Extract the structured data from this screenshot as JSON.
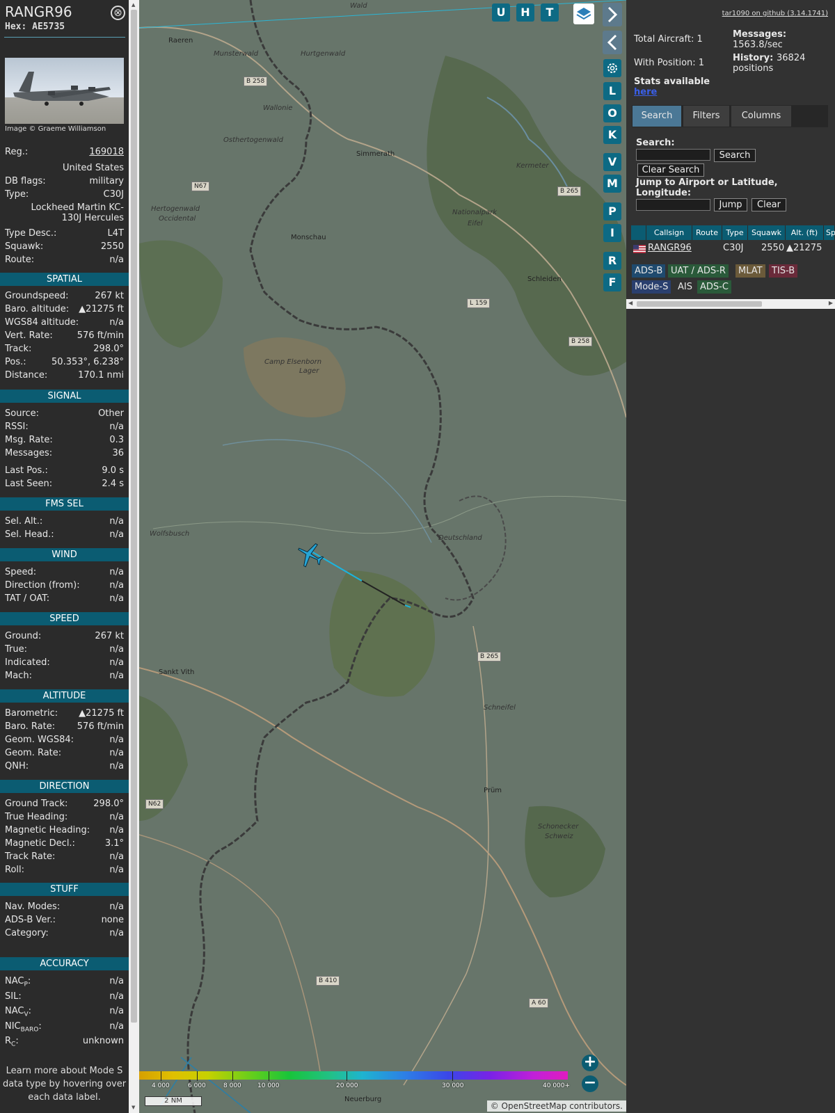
{
  "info": {
    "callsign": "RANGR96",
    "hex": "Hex: AE5735",
    "close": "⊗",
    "image_credit": "Image © Graeme Williamson",
    "reg_label": "Reg.:",
    "reg_value": "169018",
    "country": "United States",
    "dbflags_label": "DB flags:",
    "dbflags_value": "military",
    "type_label": "Type:",
    "type_value": "C30J",
    "type_full": "Lockheed Martin KC-130J Hercules",
    "typedesc_label": "Type Desc.:",
    "typedesc_value": "L4T",
    "squawk_label": "Squawk:",
    "squawk_value": "2550",
    "route_label": "Route:",
    "route_value": "n/a",
    "sections": {
      "spatial": "SPATIAL",
      "signal": "SIGNAL",
      "fms": "FMS SEL",
      "wind": "WIND",
      "speed": "SPEED",
      "altitude": "ALTITUDE",
      "direction": "DIRECTION",
      "stuff": "STUFF",
      "accuracy": "ACCURACY"
    },
    "spatial_rows": [
      [
        "Groundspeed:",
        "267 kt"
      ],
      [
        "Baro. altitude:",
        "▲21275 ft"
      ],
      [
        "WGS84 altitude:",
        "n/a"
      ],
      [
        "Vert. Rate:",
        "576 ft/min"
      ],
      [
        "Track:",
        "298.0°"
      ],
      [
        "Pos.:",
        "50.353°, 6.238°"
      ],
      [
        "Distance:",
        "170.1 nmi"
      ]
    ],
    "signal_rows": [
      [
        "Source:",
        "Other"
      ],
      [
        "RSSI:",
        "n/a"
      ],
      [
        "Msg. Rate:",
        "0.3"
      ],
      [
        "Messages:",
        "36"
      ]
    ],
    "signal_rows2": [
      [
        "Last Pos.:",
        "9.0 s"
      ],
      [
        "Last Seen:",
        "2.4 s"
      ]
    ],
    "fms_rows": [
      [
        "Sel. Alt.:",
        "n/a"
      ],
      [
        "Sel. Head.:",
        "n/a"
      ]
    ],
    "wind_rows": [
      [
        "Speed:",
        "n/a"
      ],
      [
        "Direction (from):",
        "n/a"
      ],
      [
        "TAT / OAT:",
        "n/a"
      ]
    ],
    "speed_rows": [
      [
        "Ground:",
        "267 kt"
      ],
      [
        "True:",
        "n/a"
      ],
      [
        "Indicated:",
        "n/a"
      ],
      [
        "Mach:",
        "n/a"
      ]
    ],
    "altitude_rows": [
      [
        "Barometric:",
        "▲21275 ft"
      ],
      [
        "Baro. Rate:",
        "576 ft/min"
      ],
      [
        "Geom. WGS84:",
        "n/a"
      ],
      [
        "Geom. Rate:",
        "n/a"
      ],
      [
        "QNH:",
        "n/a"
      ]
    ],
    "direction_rows": [
      [
        "Ground Track:",
        "298.0°"
      ],
      [
        "True Heading:",
        "n/a"
      ],
      [
        "Magnetic Heading:",
        "n/a"
      ],
      [
        "Magnetic Decl.:",
        "3.1°"
      ],
      [
        "Track Rate:",
        "n/a"
      ],
      [
        "Roll:",
        "n/a"
      ]
    ],
    "stuff_rows": [
      [
        "Nav. Modes:",
        "n/a"
      ],
      [
        "ADS-B Ver.:",
        "none"
      ],
      [
        "Category:",
        "n/a"
      ]
    ],
    "accuracy_rows": [
      [
        "NAC",
        "P",
        ":",
        "n/a"
      ],
      [
        "SIL:",
        "",
        "",
        "n/a"
      ],
      [
        "NAC",
        "V",
        ":",
        "n/a"
      ],
      [
        "NIC",
        "BARO",
        ":",
        "n/a"
      ],
      [
        "R",
        "C",
        ":",
        "unknown"
      ]
    ],
    "footer": "Learn more about Mode S data type by hovering over each data label."
  },
  "map": {
    "buttons_top": [
      "U",
      "H",
      "T"
    ],
    "buttons_side": [
      "L",
      "O",
      "K",
      "V",
      "M",
      "P",
      "I",
      "R",
      "F"
    ],
    "places": [
      [
        "Raeren",
        42,
        53,
        false
      ],
      [
        "Munsterwald",
        107,
        72,
        true
      ],
      [
        "Hurtgenwald",
        232,
        72,
        true
      ],
      [
        "Wald",
        303,
        3,
        true
      ],
      [
        "Wallonie",
        178,
        150,
        true
      ],
      [
        "Osthertogenwald",
        121,
        196,
        true
      ],
      [
        "Simmerath",
        312,
        216,
        false
      ],
      [
        "Kermeter",
        542,
        233,
        true
      ],
      [
        "Hertogenwald",
        17,
        295,
        true
      ],
      [
        "Occidental",
        28,
        309,
        true
      ],
      [
        "Nationalpark",
        450,
        300,
        true
      ],
      [
        "Eifel",
        472,
        316,
        true
      ],
      [
        "Monschau",
        218,
        336,
        false
      ],
      [
        "Schleiden",
        558,
        396,
        false
      ],
      [
        "Camp Elsenborn",
        180,
        515,
        true
      ],
      [
        "Lager",
        230,
        528,
        true
      ],
      [
        "Wolfsbusch",
        15,
        762,
        true
      ],
      [
        "Deutschland",
        430,
        768,
        true
      ],
      [
        "Sankt Vith",
        28,
        961,
        false
      ],
      [
        "Schneifel",
        495,
        1012,
        true
      ],
      [
        "Prüm",
        495,
        1131,
        false
      ],
      [
        "Schonecker",
        573,
        1183,
        true
      ],
      [
        "Schweiz",
        583,
        1197,
        true
      ],
      [
        "Neuerburg",
        295,
        1575,
        false
      ]
    ],
    "roads": [
      [
        "B 258",
        150,
        110
      ],
      [
        "N67",
        75,
        261
      ],
      [
        "B 265",
        601,
        268
      ],
      [
        "L 159",
        471,
        429
      ],
      [
        "B 258",
        617,
        484
      ],
      [
        "B 265",
        486,
        937
      ],
      [
        "N62",
        9,
        1149
      ],
      [
        "B 410",
        254,
        1403
      ],
      [
        "A 60",
        560,
        1435
      ]
    ],
    "colorbar_labels": [
      "4 000",
      "6 000",
      "8 000",
      "10 000",
      "20 000",
      "30 000",
      "40 000+"
    ],
    "scale": "2 NM",
    "attribution": "© OpenStreetMap contributors."
  },
  "side": {
    "github": "tar1090 on github (3.14.1741)",
    "total_aircraft": "Total Aircraft: 1",
    "with_position": "With Position: 1",
    "messages_label": "Messages:",
    "messages_value": "1563.8/sec",
    "history_label": "History:",
    "history_value": "36824 positions",
    "stats_label": "Stats available",
    "stats_link": "here",
    "tabs": [
      "Search",
      "Filters",
      "Columns"
    ],
    "search_label": "Search:",
    "search_btn": "Search",
    "clear_search": "Clear Search",
    "jump_label": "Jump to Airport or Latitude, Longitude:",
    "jump_btn": "Jump",
    "clear_btn": "Clear",
    "columns": [
      "Callsign",
      "Route",
      "Type",
      "Squawk",
      "Alt. (ft)",
      "Sp"
    ],
    "row": {
      "callsign": "RANGR96",
      "type": "C30J",
      "squawk": "2550",
      "alt": "▲21275"
    },
    "sources": [
      [
        "ADS-B",
        "#1f4a6e"
      ],
      [
        "UAT / ADS-R",
        "#2a5a3a"
      ],
      [
        "MLAT",
        "#6b5a3a"
      ],
      [
        "TIS-B",
        "#6a2a3a"
      ],
      [
        "Mode-S",
        "#2a3f6e"
      ],
      [
        "AIS",
        "#323232"
      ],
      [
        "ADS-C",
        "#2a5a3a"
      ]
    ]
  }
}
